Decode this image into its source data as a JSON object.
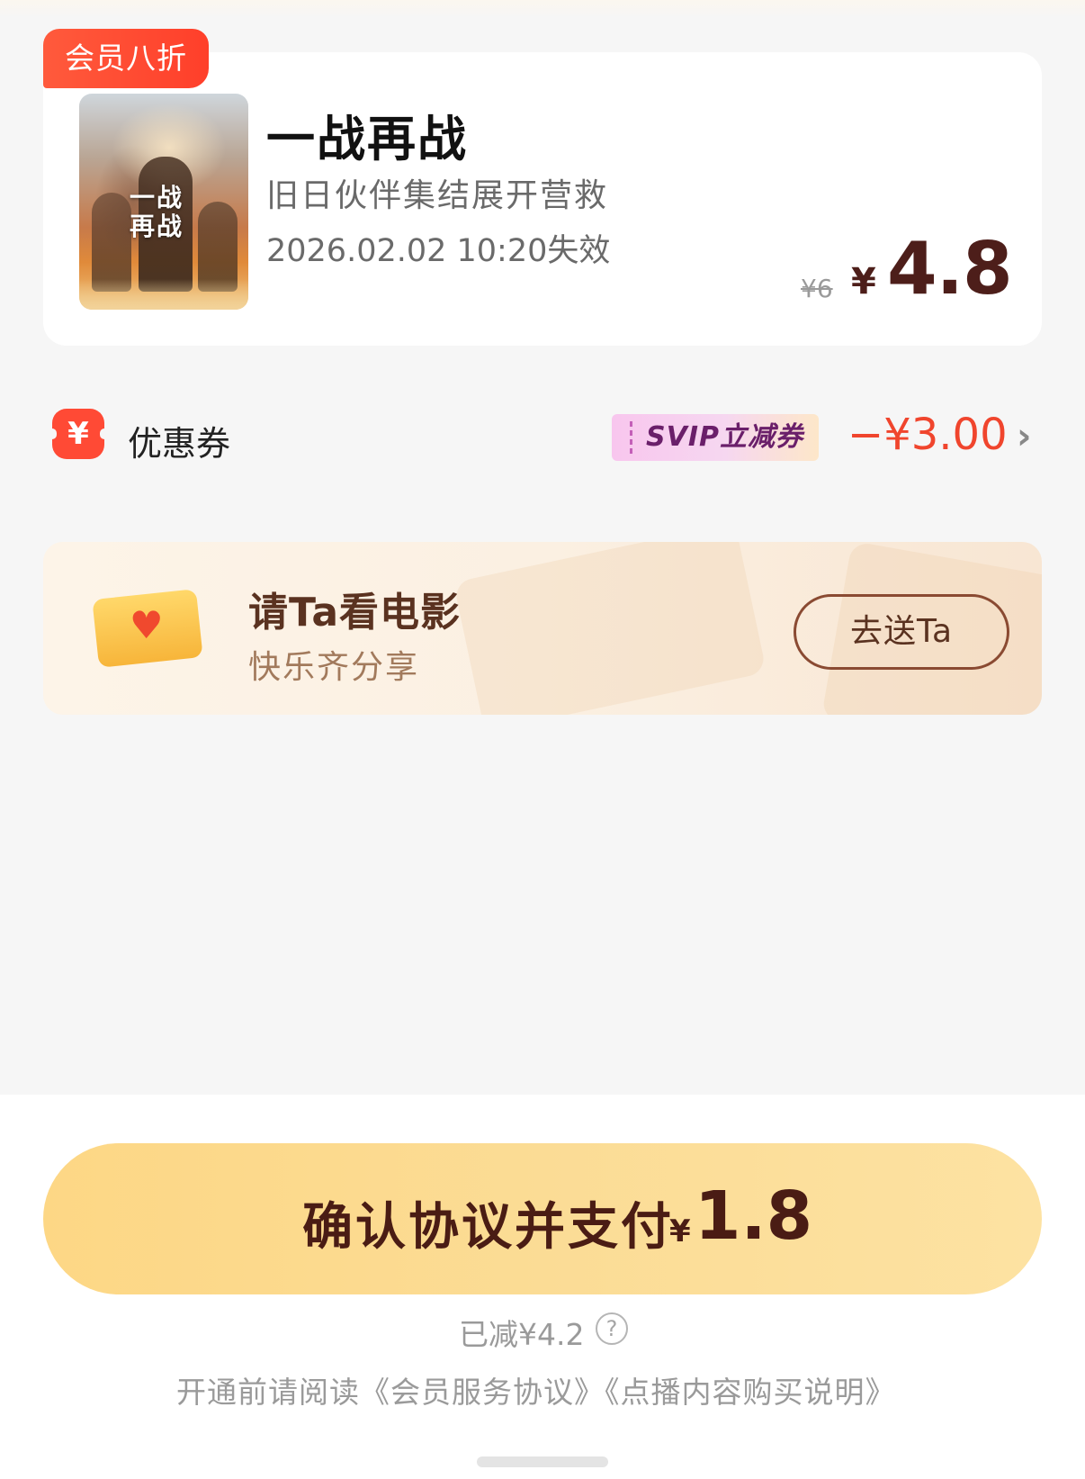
{
  "movie": {
    "badge": "会员八折",
    "poster_title": "一战再战",
    "title": "一战再战",
    "subtitle": "旧日伙伴集结展开营救",
    "expiry": "2026.02.02 10:20失效",
    "original_price": "¥6",
    "currency": "¥",
    "price": "4.8"
  },
  "coupon": {
    "icon_symbol": "¥",
    "label": "优惠券",
    "tag": "SVIP立减券",
    "value": "−¥3.00",
    "chevron": "›"
  },
  "gift": {
    "title": "请Ta看电影",
    "subtitle": "快乐齐分享",
    "button": "去送Ta",
    "icon": "heart-ticket-icon",
    "heart": "♥"
  },
  "payment": {
    "label": "确认协议并支付",
    "currency": "¥",
    "amount": "1.8",
    "discount": "已减¥4.2",
    "help": "?"
  },
  "agreement": {
    "prefix": "开通前请阅读",
    "link1": "《会员服务协议》",
    "link2": "《点播内容购买说明》"
  },
  "colors": {
    "badge": "#ff4a35",
    "price": "#4d1e1a",
    "coupon_value": "#f0452d",
    "pay_button": "#fcd98c"
  }
}
